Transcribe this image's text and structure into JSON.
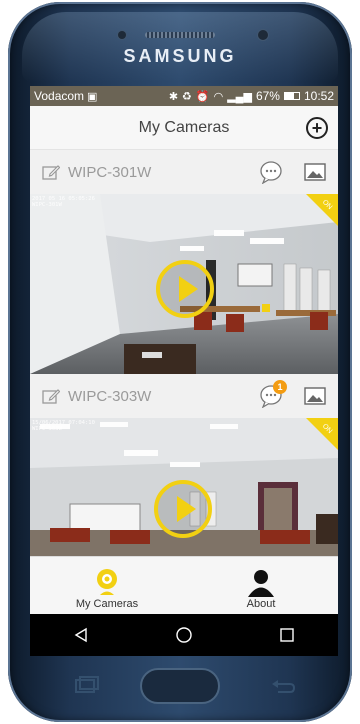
{
  "device": {
    "brand": "SAMSUNG"
  },
  "status_bar": {
    "carrier": "Vodacom",
    "battery": "67%",
    "time": "10:52",
    "battery_level": 0.67
  },
  "app_bar": {
    "title": "My Cameras",
    "add_icon": "plus-circle-icon"
  },
  "cameras": [
    {
      "name": "WIPC-301W",
      "timestamp": "2017 05 16 05:05:26\nWIPC-301W",
      "badge": "",
      "status": "ON"
    },
    {
      "name": "WIPC-303W",
      "timestamp": "15/06/2017 07:04:10\nWIPC-303W",
      "badge": "1",
      "status": "ON"
    }
  ],
  "bottom_nav": {
    "my_cameras_label": "My Cameras",
    "about_label": "About"
  },
  "colors": {
    "accent": "#f2d012",
    "badge": "#f39c12",
    "status_bar": "#6b6455"
  }
}
